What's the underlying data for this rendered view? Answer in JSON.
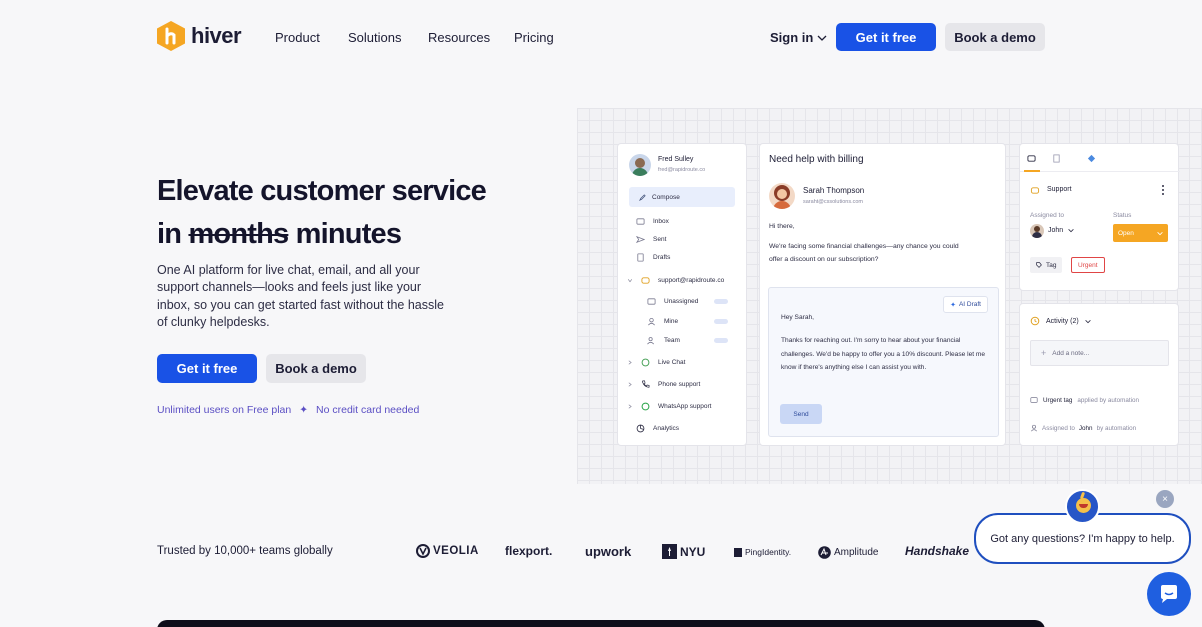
{
  "nav": {
    "logo_text": "hiver",
    "links": [
      "Product",
      "Solutions",
      "Resources",
      "Pricing"
    ],
    "sign_in": "Sign in",
    "get_free": "Get it free",
    "book_demo": "Book a demo"
  },
  "hero": {
    "title_line1": "Elevate customer service",
    "title_in": "in",
    "title_struck": "months",
    "title_end": "minutes",
    "subtitle": "One AI platform for live chat, email, and all your support channels—looks and feels just like your inbox, so you can get started fast without the hassle of clunky helpdesks.",
    "cta_primary": "Get it free",
    "cta_secondary": "Book a demo",
    "perk1": "Unlimited users on Free plan",
    "perk_sep": "✦",
    "perk2": "No credit card needed"
  },
  "mock": {
    "sidebar": {
      "user_name": "Fred Sulley",
      "user_email": "fred@rapidroute.co",
      "compose": "Compose",
      "inbox": "Inbox",
      "sent": "Sent",
      "drafts": "Drafts",
      "shared_inbox": "support@rapidroute.co",
      "unassigned": "Unassigned",
      "mine": "Mine",
      "team": "Team",
      "live_chat": "Live Chat",
      "phone": "Phone support",
      "whatsapp": "WhatsApp support",
      "analytics": "Analytics"
    },
    "email": {
      "subject": "Need help with billing",
      "sender_name": "Sarah Thompson",
      "sender_email": "saraht@cssolutions.com",
      "greeting": "Hi there,",
      "body": "We're facing some financial challenges—any chance you could offer a discount on our subscription?",
      "ai_badge": "AI Draft",
      "reply_greeting": "Hey Sarah,",
      "reply_body": "Thanks for reaching out. I'm sorry to hear about your financial challenges. We'd be happy to offer you a 10% discount. Please let me know if there's anything else I can assist you with.",
      "send": "Send"
    },
    "details": {
      "category": "Support",
      "assigned_label": "Assigned to",
      "status_label": "Status",
      "assignee": "John",
      "status": "Open",
      "tag_label": "Tag",
      "tag": "Urgent",
      "activity": "Activity (2)",
      "add_note": "Add a note...",
      "log1_bold": "Urgent tag",
      "log1_rest": "applied by automation",
      "log2_pre": "Assigned to",
      "log2_bold": "John",
      "log2_rest": "by automation"
    }
  },
  "trust": {
    "label": "Trusted by 10,000+ teams globally",
    "logos": [
      "VEOLIA",
      "flexport.",
      "upwork",
      "NYU",
      "PingIdentity.",
      "Amplitude",
      "Handshake"
    ]
  },
  "chat": {
    "message": "Got any questions? I'm happy to help.",
    "close": "×"
  },
  "colors": {
    "accent": "#1952e6",
    "brand_orange": "#f5a623",
    "status_open": "#f5a623",
    "urgent": "#e04545",
    "perk_text": "#5b4fc4"
  }
}
